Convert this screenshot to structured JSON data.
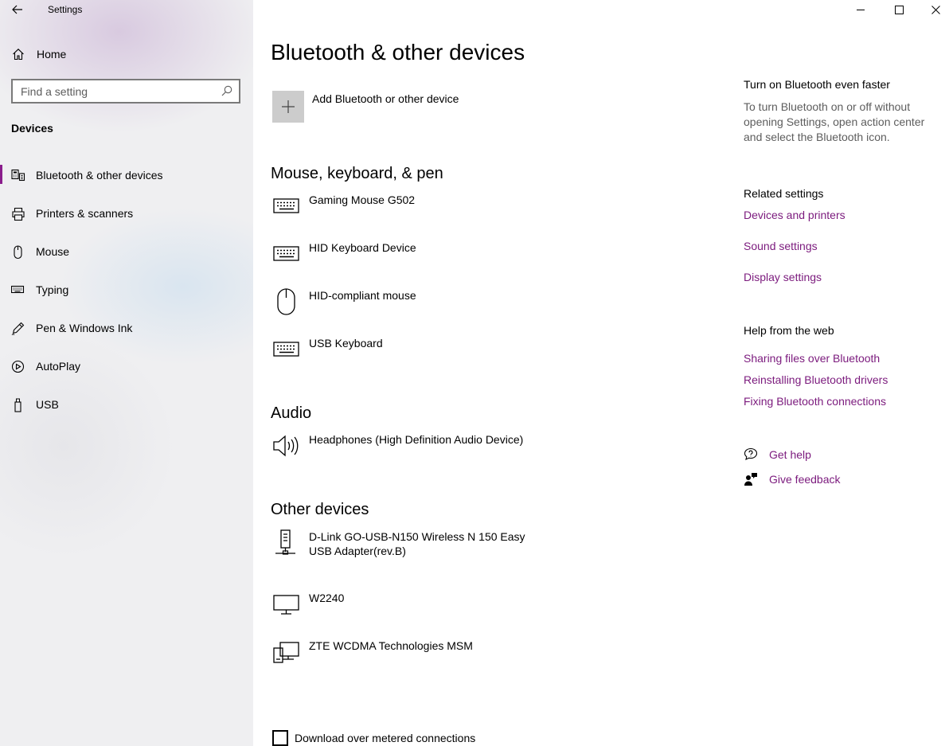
{
  "window": {
    "app_title": "Settings",
    "controls": [
      "minimize-icon",
      "maximize-icon",
      "close-icon"
    ]
  },
  "sidebar": {
    "home_label": "Home",
    "search_placeholder": "Find a setting",
    "section_label": "Devices",
    "items": [
      {
        "label": "Bluetooth & other devices",
        "icon": "bluetooth-devices-icon",
        "active": true
      },
      {
        "label": "Printers & scanners",
        "icon": "printer-icon",
        "active": false
      },
      {
        "label": "Mouse",
        "icon": "mouse-icon",
        "active": false
      },
      {
        "label": "Typing",
        "icon": "keyboard-icon",
        "active": false
      },
      {
        "label": "Pen & Windows Ink",
        "icon": "pen-icon",
        "active": false
      },
      {
        "label": "AutoPlay",
        "icon": "autoplay-icon",
        "active": false
      },
      {
        "label": "USB",
        "icon": "usb-icon",
        "active": false
      }
    ]
  },
  "main": {
    "title": "Bluetooth & other devices",
    "add_device_label": "Add Bluetooth or other device",
    "groups": {
      "mouse_keyboard": {
        "title": "Mouse, keyboard, & pen",
        "devices": [
          {
            "name": "Gaming Mouse G502",
            "icon": "keyboard-icon"
          },
          {
            "name": "HID Keyboard Device",
            "icon": "keyboard-icon"
          },
          {
            "name": "HID-compliant mouse",
            "icon": "mouse-icon"
          },
          {
            "name": "USB Keyboard",
            "icon": "keyboard-icon"
          }
        ]
      },
      "audio": {
        "title": "Audio",
        "devices": [
          {
            "name": "Headphones (High Definition Audio Device)",
            "icon": "speaker-icon"
          }
        ]
      },
      "other": {
        "title": "Other devices",
        "devices": [
          {
            "name": "D-Link GO-USB-N150 Wireless N 150 Easy USB Adapter(rev.B)",
            "icon": "network-adapter-icon"
          },
          {
            "name": "W2240",
            "icon": "monitor-icon"
          },
          {
            "name": "ZTE WCDMA Technologies MSM",
            "icon": "generic-device-icon"
          }
        ]
      }
    },
    "metered_label": "Download over metered connections"
  },
  "right": {
    "bt_faster_title": "Turn on Bluetooth even faster",
    "bt_faster_desc": "To turn Bluetooth on or off without opening Settings, open action center and select the Bluetooth icon.",
    "related_title": "Related settings",
    "related_links": [
      "Devices and printers",
      "Sound settings",
      "Display settings"
    ],
    "help_title": "Help from the web",
    "help_links": [
      "Sharing files over Bluetooth",
      "Reinstalling Bluetooth drivers",
      "Fixing Bluetooth connections"
    ],
    "get_help": "Get help",
    "give_feedback": "Give feedback"
  },
  "colors": {
    "accent": "#7b1a7d",
    "active_indicator": "#8a1d8c",
    "add_tile": "#cccccc"
  }
}
